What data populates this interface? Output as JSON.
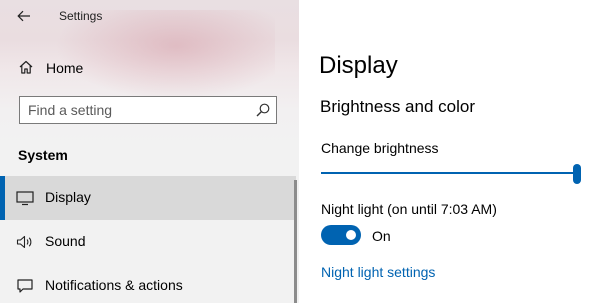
{
  "window": {
    "title": "Settings"
  },
  "sidebar": {
    "home_label": "Home",
    "search_placeholder": "Find a setting",
    "section_title": "System",
    "items": [
      {
        "label": "Display",
        "icon": "monitor-icon",
        "selected": true
      },
      {
        "label": "Sound",
        "icon": "speaker-icon",
        "selected": false
      },
      {
        "label": "Notifications & actions",
        "icon": "notification-icon",
        "selected": false
      }
    ]
  },
  "main": {
    "title": "Display",
    "section_title": "Brightness and color",
    "brightness_label": "Change brightness",
    "brightness_value": 100,
    "night_light_label": "Night light (on until 7:03 AM)",
    "night_light_state": "On",
    "night_light_settings_link": "Night light settings"
  },
  "colors": {
    "accent": "#0063b1",
    "selected_bg": "#d9d9d9",
    "sidebar_bg": "#f2f2f2"
  }
}
